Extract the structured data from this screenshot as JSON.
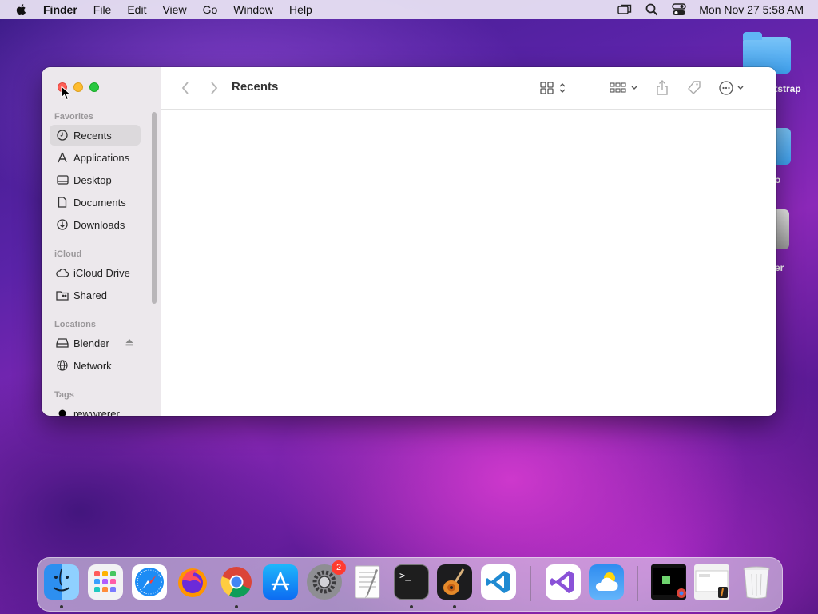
{
  "menubar": {
    "app_name": "Finder",
    "menus": [
      "File",
      "Edit",
      "View",
      "Go",
      "Window",
      "Help"
    ],
    "clock": "Mon Nov 27  5:58 AM",
    "status_icons": [
      "screen-mirroring-icon",
      "spotlight-icon",
      "control-center-icon"
    ]
  },
  "desktop": {
    "items": [
      {
        "label": "otstrap",
        "icon": "folder-icon"
      },
      {
        "label": "o",
        "icon": "folder-icon"
      },
      {
        "label": "er",
        "icon": "drive-icon"
      }
    ]
  },
  "finder": {
    "title": "Recents",
    "sidebar": {
      "favorites_header": "Favorites",
      "favorites": [
        {
          "label": "Recents",
          "icon": "clock-icon",
          "selected": true
        },
        {
          "label": "Applications",
          "icon": "applications-icon"
        },
        {
          "label": "Desktop",
          "icon": "desktop-icon"
        },
        {
          "label": "Documents",
          "icon": "document-icon"
        },
        {
          "label": "Downloads",
          "icon": "download-icon"
        }
      ],
      "icloud_header": "iCloud",
      "icloud": [
        {
          "label": "iCloud Drive",
          "icon": "cloud-icon"
        },
        {
          "label": "Shared",
          "icon": "shared-folder-icon"
        }
      ],
      "locations_header": "Locations",
      "locations": [
        {
          "label": "Blender",
          "icon": "drive-icon",
          "ejectable": true
        },
        {
          "label": "Network",
          "icon": "globe-icon"
        }
      ],
      "tags_header": "Tags",
      "tags": [
        {
          "label": "rewwrerer",
          "color": "#000000"
        }
      ]
    },
    "toolbar_icons": [
      "back-icon",
      "forward-icon",
      "view-grid-icon",
      "group-icon",
      "share-icon",
      "tag-icon",
      "more-icon",
      "search-icon"
    ]
  },
  "dock": {
    "apps": [
      {
        "name": "Finder",
        "running": true
      },
      {
        "name": "Launchpad",
        "running": false
      },
      {
        "name": "Safari",
        "running": false
      },
      {
        "name": "Firefox",
        "running": false
      },
      {
        "name": "Chrome",
        "running": true
      },
      {
        "name": "App Store",
        "running": false
      },
      {
        "name": "System Preferences",
        "running": false,
        "badge": "2"
      },
      {
        "name": "TextEdit",
        "running": false
      },
      {
        "name": "Terminal",
        "running": true
      },
      {
        "name": "GarageBand",
        "running": true
      },
      {
        "name": "VS Code",
        "running": false
      },
      {
        "name": "Visual Studio",
        "running": false
      },
      {
        "name": "Weather",
        "running": false
      }
    ],
    "terminal_glyph": ">_",
    "trash": "Trash"
  }
}
